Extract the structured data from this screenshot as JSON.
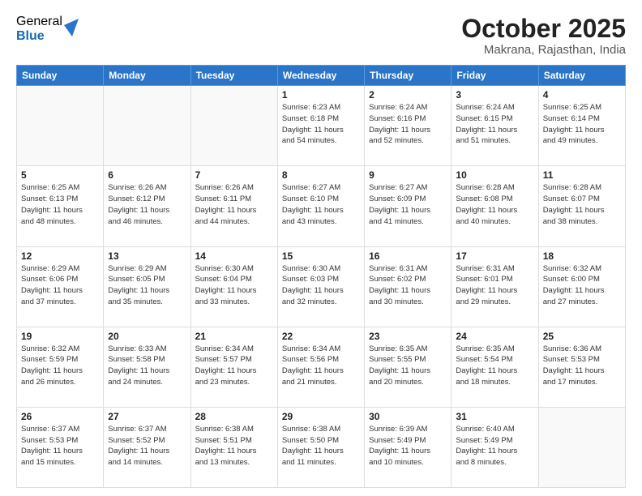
{
  "logo": {
    "general": "General",
    "blue": "Blue"
  },
  "header": {
    "month": "October 2025",
    "location": "Makrana, Rajasthan, India"
  },
  "weekdays": [
    "Sunday",
    "Monday",
    "Tuesday",
    "Wednesday",
    "Thursday",
    "Friday",
    "Saturday"
  ],
  "weeks": [
    [
      {
        "day": "",
        "info": ""
      },
      {
        "day": "",
        "info": ""
      },
      {
        "day": "",
        "info": ""
      },
      {
        "day": "1",
        "info": "Sunrise: 6:23 AM\nSunset: 6:18 PM\nDaylight: 11 hours\nand 54 minutes."
      },
      {
        "day": "2",
        "info": "Sunrise: 6:24 AM\nSunset: 6:16 PM\nDaylight: 11 hours\nand 52 minutes."
      },
      {
        "day": "3",
        "info": "Sunrise: 6:24 AM\nSunset: 6:15 PM\nDaylight: 11 hours\nand 51 minutes."
      },
      {
        "day": "4",
        "info": "Sunrise: 6:25 AM\nSunset: 6:14 PM\nDaylight: 11 hours\nand 49 minutes."
      }
    ],
    [
      {
        "day": "5",
        "info": "Sunrise: 6:25 AM\nSunset: 6:13 PM\nDaylight: 11 hours\nand 48 minutes."
      },
      {
        "day": "6",
        "info": "Sunrise: 6:26 AM\nSunset: 6:12 PM\nDaylight: 11 hours\nand 46 minutes."
      },
      {
        "day": "7",
        "info": "Sunrise: 6:26 AM\nSunset: 6:11 PM\nDaylight: 11 hours\nand 44 minutes."
      },
      {
        "day": "8",
        "info": "Sunrise: 6:27 AM\nSunset: 6:10 PM\nDaylight: 11 hours\nand 43 minutes."
      },
      {
        "day": "9",
        "info": "Sunrise: 6:27 AM\nSunset: 6:09 PM\nDaylight: 11 hours\nand 41 minutes."
      },
      {
        "day": "10",
        "info": "Sunrise: 6:28 AM\nSunset: 6:08 PM\nDaylight: 11 hours\nand 40 minutes."
      },
      {
        "day": "11",
        "info": "Sunrise: 6:28 AM\nSunset: 6:07 PM\nDaylight: 11 hours\nand 38 minutes."
      }
    ],
    [
      {
        "day": "12",
        "info": "Sunrise: 6:29 AM\nSunset: 6:06 PM\nDaylight: 11 hours\nand 37 minutes."
      },
      {
        "day": "13",
        "info": "Sunrise: 6:29 AM\nSunset: 6:05 PM\nDaylight: 11 hours\nand 35 minutes."
      },
      {
        "day": "14",
        "info": "Sunrise: 6:30 AM\nSunset: 6:04 PM\nDaylight: 11 hours\nand 33 minutes."
      },
      {
        "day": "15",
        "info": "Sunrise: 6:30 AM\nSunset: 6:03 PM\nDaylight: 11 hours\nand 32 minutes."
      },
      {
        "day": "16",
        "info": "Sunrise: 6:31 AM\nSunset: 6:02 PM\nDaylight: 11 hours\nand 30 minutes."
      },
      {
        "day": "17",
        "info": "Sunrise: 6:31 AM\nSunset: 6:01 PM\nDaylight: 11 hours\nand 29 minutes."
      },
      {
        "day": "18",
        "info": "Sunrise: 6:32 AM\nSunset: 6:00 PM\nDaylight: 11 hours\nand 27 minutes."
      }
    ],
    [
      {
        "day": "19",
        "info": "Sunrise: 6:32 AM\nSunset: 5:59 PM\nDaylight: 11 hours\nand 26 minutes."
      },
      {
        "day": "20",
        "info": "Sunrise: 6:33 AM\nSunset: 5:58 PM\nDaylight: 11 hours\nand 24 minutes."
      },
      {
        "day": "21",
        "info": "Sunrise: 6:34 AM\nSunset: 5:57 PM\nDaylight: 11 hours\nand 23 minutes."
      },
      {
        "day": "22",
        "info": "Sunrise: 6:34 AM\nSunset: 5:56 PM\nDaylight: 11 hours\nand 21 minutes."
      },
      {
        "day": "23",
        "info": "Sunrise: 6:35 AM\nSunset: 5:55 PM\nDaylight: 11 hours\nand 20 minutes."
      },
      {
        "day": "24",
        "info": "Sunrise: 6:35 AM\nSunset: 5:54 PM\nDaylight: 11 hours\nand 18 minutes."
      },
      {
        "day": "25",
        "info": "Sunrise: 6:36 AM\nSunset: 5:53 PM\nDaylight: 11 hours\nand 17 minutes."
      }
    ],
    [
      {
        "day": "26",
        "info": "Sunrise: 6:37 AM\nSunset: 5:53 PM\nDaylight: 11 hours\nand 15 minutes."
      },
      {
        "day": "27",
        "info": "Sunrise: 6:37 AM\nSunset: 5:52 PM\nDaylight: 11 hours\nand 14 minutes."
      },
      {
        "day": "28",
        "info": "Sunrise: 6:38 AM\nSunset: 5:51 PM\nDaylight: 11 hours\nand 13 minutes."
      },
      {
        "day": "29",
        "info": "Sunrise: 6:38 AM\nSunset: 5:50 PM\nDaylight: 11 hours\nand 11 minutes."
      },
      {
        "day": "30",
        "info": "Sunrise: 6:39 AM\nSunset: 5:49 PM\nDaylight: 11 hours\nand 10 minutes."
      },
      {
        "day": "31",
        "info": "Sunrise: 6:40 AM\nSunset: 5:49 PM\nDaylight: 11 hours\nand 8 minutes."
      },
      {
        "day": "",
        "info": ""
      }
    ]
  ]
}
